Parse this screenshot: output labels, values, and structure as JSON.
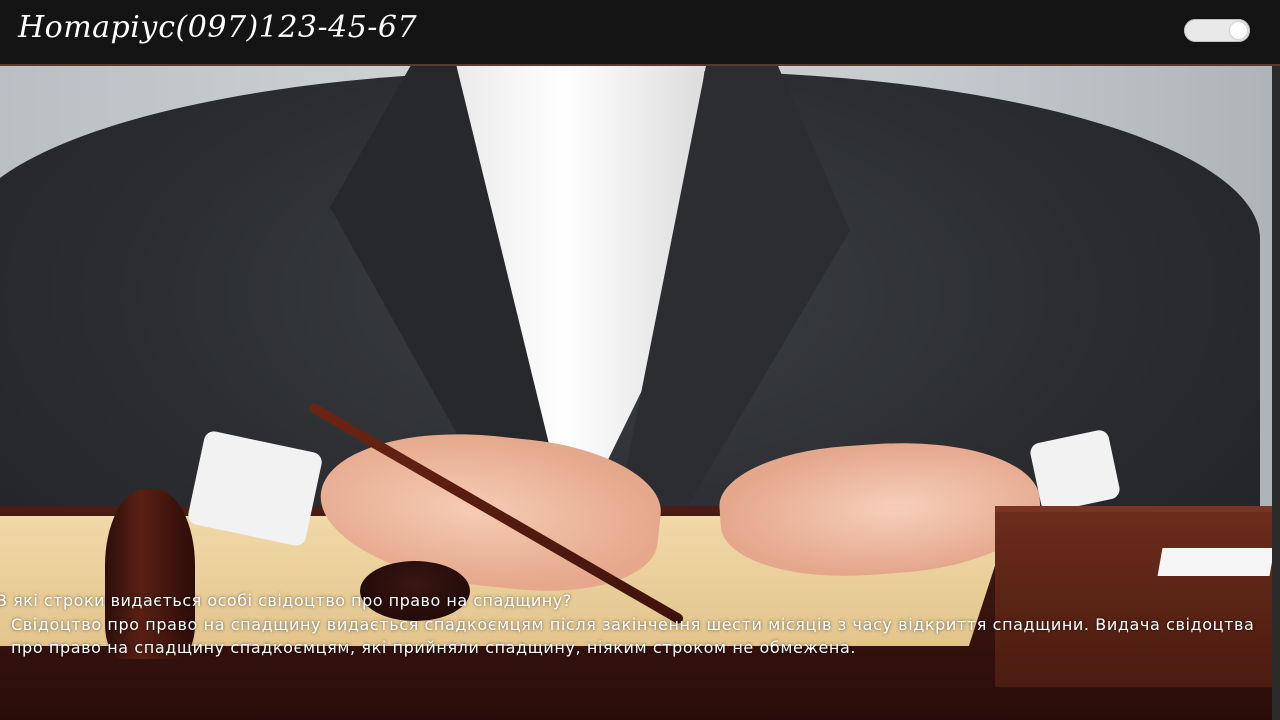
{
  "header": {
    "brand_title": "Нотаріус(097)123-45-67",
    "theme_toggle_state": "on"
  },
  "colors": {
    "header_bg": "#141414",
    "header_border": "#5a3a30",
    "text": "#ffffff",
    "toggle_bg": "#e9e9e9"
  },
  "faq": {
    "question": "В які строки видається особі свідоцтво про право на спадщину?",
    "answer": "Свідоцтво про право на спадщину видається спадкоємцям після закінчення шести місяців з часу відкриття спадщини. Видача свідоцтва про право на спадщину спадкоємцям, які прийняли спадщину, ніяким строком не обмежена."
  }
}
